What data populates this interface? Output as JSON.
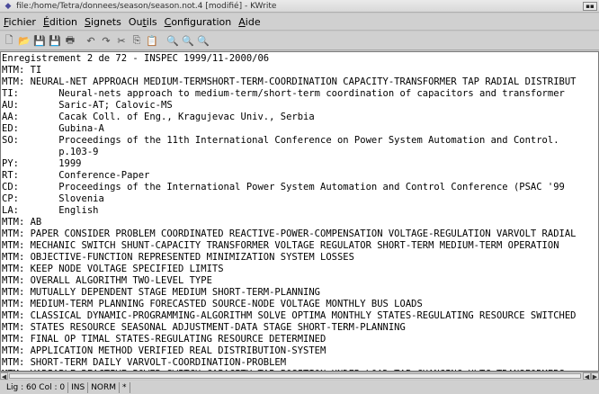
{
  "window": {
    "title": "file:/home/Tetra/donnees/season/season.not.4 [modifié] - KWrite"
  },
  "menu": [
    {
      "pre": "",
      "u": "F",
      "post": "ichier"
    },
    {
      "pre": "",
      "u": "É",
      "post": "dition"
    },
    {
      "pre": "",
      "u": "S",
      "post": "ignets"
    },
    {
      "pre": "Ou",
      "u": "t",
      "post": "ils"
    },
    {
      "pre": "",
      "u": "C",
      "post": "onfiguration"
    },
    {
      "pre": "",
      "u": "A",
      "post": "ide"
    }
  ],
  "toolbar_icons": [
    {
      "name": "new-file-icon",
      "glyph": "🗋"
    },
    {
      "name": "open-file-icon",
      "glyph": "📂"
    },
    {
      "name": "save-file-icon",
      "glyph": "💾"
    },
    {
      "name": "save-as-icon",
      "glyph": "💾"
    },
    {
      "name": "print-icon",
      "glyph": "🖶"
    },
    {
      "name": "undo-icon",
      "glyph": "↶"
    },
    {
      "name": "redo-icon",
      "glyph": "↷"
    },
    {
      "name": "cut-icon",
      "glyph": "✂"
    },
    {
      "name": "copy-icon",
      "glyph": "⎘"
    },
    {
      "name": "paste-icon",
      "glyph": "📋"
    },
    {
      "name": "find-icon",
      "glyph": "🔍"
    },
    {
      "name": "zoom-in-icon",
      "glyph": "🔍"
    },
    {
      "name": "zoom-out-icon",
      "glyph": "🔍"
    }
  ],
  "document": {
    "lines": [
      "Enregistrement 2 de 72 - INSPEC 1999/11-2000/06",
      "MTM: TI",
      "MTM: NEURAL-NET APPROACH MEDIUM-TERMSHORT-TERM-COORDINATION CAPACITY-TRANSFORMER TAP RADIAL DISTRIBUT",
      "TI:       Neural-nets approach to medium-term/short-term coordination of capacitors and transformer",
      "AU:       Saric-AT; Calovic-MS",
      "AA:       Cacak Coll. of Eng., Kragujevac Univ., Serbia",
      "ED:       Gubina-A",
      "SO:       Proceedings of the 11th International Conference on Power System Automation and Control.",
      "          p.103-9",
      "PY:       1999",
      "RT:       Conference-Paper",
      "CD:       Proceedings of the International Power System Automation and Control Conference (PSAC '99",
      "CP:       Slovenia",
      "LA:       English",
      "MTM: AB",
      "MTM: PAPER CONSIDER PROBLEM COORDINATED REACTIVE-POWER-COMPENSATION VOLTAGE-REGULATION VARVOLT RADIAL",
      "MTM: MECHANIC SWITCH SHUNT-CAPACITY TRANSFORMER VOLTAGE REGULATOR SHORT-TERM MEDIUM-TERM OPERATION",
      "MTM: OBJECTIVE-FUNCTION REPRESENTED MINIMIZATION SYSTEM LOSSES",
      "MTM: KEEP NODE VOLTAGE SPECIFIED LIMITS",
      "MTM: OVERALL ALGORITHM TWO-LEVEL TYPE",
      "MTM: MUTUALLY DEPENDENT STAGE MEDIUM SHORT-TERM-PLANNING",
      "MTM: MEDIUM-TERM PLANNING FORECASTED SOURCE-NODE VOLTAGE MONTHLY BUS LOADS",
      "MTM: CLASSICAL DYNAMIC-PROGRAMMING-ALGORITHM SOLVE OPTIMA MONTHLY STATES-REGULATING RESOURCE SWITCHED",
      "MTM: STATES RESOURCE SEASONAL ADJUSTMENT-DATA STAGE SHORT-TERM-PLANNING",
      "MTM: FINAL OP TIMAL STATES-REGULATING RESOURCE DETERMINED",
      "MTM: APPLICATION METHOD VERIFIED REAL DISTRIBUTION-SYSTEM",
      "MTM: SHORT-TERM DAILY VARVOLT-COORDINATION-PROBLEM",
      "MTM: VARIABLE REACTIVE POWER SWITCH CAPACITY TAP POSITION UNDER LOAD TAP CHANGING ULTC TRANSFORMERS"
    ]
  },
  "status": {
    "position": "Lig : 60 Col : 0",
    "mode": "INS",
    "norm": "NORM",
    "modified": "*"
  }
}
